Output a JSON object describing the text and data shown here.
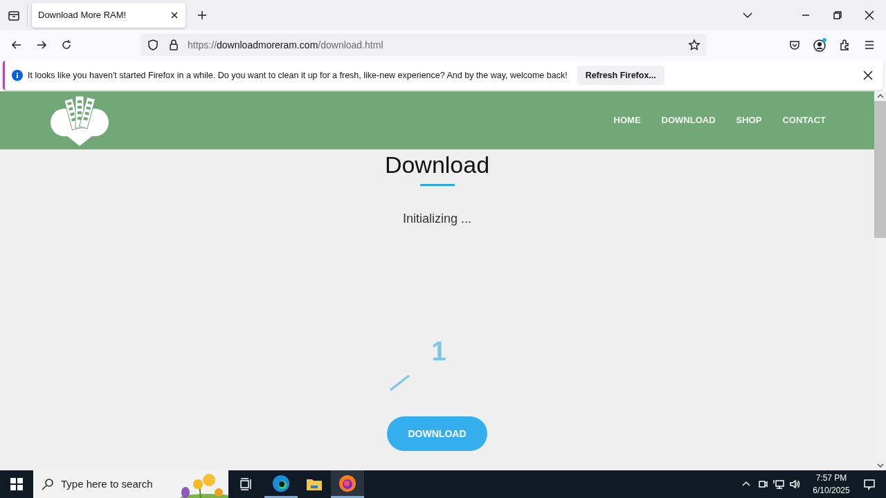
{
  "browser": {
    "tabs": [
      {
        "title": "Download More RAM!",
        "selected": true
      }
    ],
    "url": {
      "scheme": "https://",
      "domain": "downloadmoreram.com",
      "path": "/download.html"
    },
    "notification": {
      "message": "It looks like you haven't started Firefox in a while. Do you want to clean it up for a fresh, like-new experience? And by the way, welcome back!",
      "button": "Refresh Firefox..."
    }
  },
  "site": {
    "nav": [
      {
        "label": "HOME"
      },
      {
        "label": "DOWNLOAD"
      },
      {
        "label": "SHOP"
      },
      {
        "label": "CONTACT"
      }
    ],
    "heading": "Download",
    "status": "Initializing ...",
    "counter": "1",
    "download_button": "DOWNLOAD"
  },
  "taskbar": {
    "search_placeholder": "Type here to search",
    "time": "7:57 PM",
    "date": "6/10/2025"
  }
}
